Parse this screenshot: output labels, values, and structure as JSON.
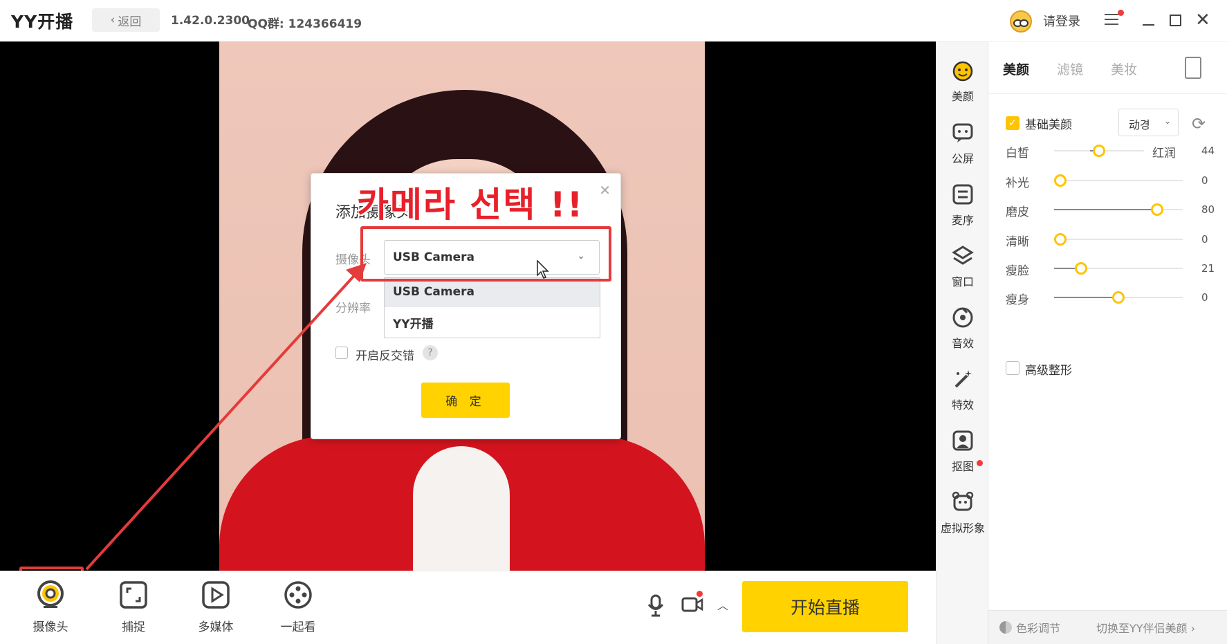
{
  "titlebar": {
    "logo": "YY开播",
    "back_label": "返回",
    "version": "1.42.0.2300",
    "qq_group": "QQ群: 124366419",
    "login_label": "请登录"
  },
  "dialog": {
    "title": "添加摄像头",
    "camera_label": "摄像头",
    "resolution_label": "分辨率",
    "selected_camera": "USB Camera",
    "options": [
      "USB Camera",
      "YY开播"
    ],
    "mirror_label": "开启反交错",
    "help": "?",
    "ok_label": "确 定"
  },
  "annotation": {
    "text": "카메라 선택 !!",
    "color": "#e8202a"
  },
  "toolbar": {
    "camera_label": "摄像头",
    "capture_label": "捕捉",
    "media_label": "多媒体",
    "watch_label": "一起看",
    "start_label": "开始直播"
  },
  "sidenav": {
    "items": [
      "美颜",
      "公屏",
      "麦序",
      "窗口",
      "音效",
      "特效",
      "抠图",
      "虚拟形象"
    ]
  },
  "panel": {
    "tabs": [
      "美颜",
      "滤镜",
      "美妆"
    ],
    "basic_label": "基础美颜",
    "preset": "动경",
    "sliders": [
      {
        "label": "白皙",
        "right_label": "红润",
        "value": "44",
        "level": 0.5
      },
      {
        "label": "补光",
        "right_label": "",
        "value": "0",
        "level": 0.0
      },
      {
        "label": "磨皮",
        "right_label": "",
        "value": "80",
        "level": 0.8
      },
      {
        "label": "清晰",
        "right_label": "",
        "value": "0",
        "level": 0.0
      },
      {
        "label": "瘦脸",
        "right_label": "",
        "value": "21",
        "level": 0.21
      },
      {
        "label": "瘦身",
        "right_label": "",
        "value": "0",
        "level": 0.5
      }
    ],
    "advanced_label": "高级整形",
    "color_adjust": "色彩调节",
    "switch_link": "切换至YY伴侣美颜"
  },
  "colors": {
    "accent": "#ffd200",
    "annotation_red": "#e53b3b",
    "knob": "#ffc400"
  }
}
